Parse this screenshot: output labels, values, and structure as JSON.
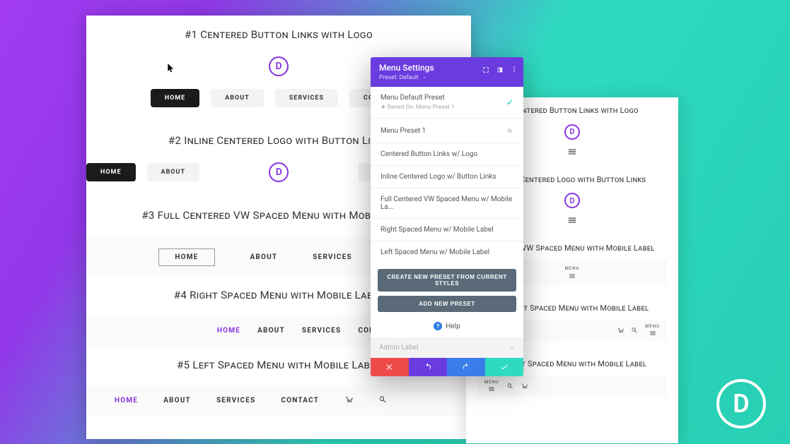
{
  "sections": {
    "s1": {
      "title": "#1 Centered Button Links with Logo"
    },
    "s2": {
      "title": "#2 Inline Centered Logo with Button Links"
    },
    "s3": {
      "title": "#3 Full Centered VW Spaced Menu with Mobile Label"
    },
    "s4": {
      "title": "#4 Right Spaced Menu with Mobile Label"
    },
    "s5": {
      "title": "#5 Left Spaced Menu with Mobile Label"
    }
  },
  "menu": {
    "home": "HOME",
    "about": "ABOUT",
    "services": "SERVICES",
    "contact": "CONTACT",
    "contact_trunc": "CONTAC",
    "contact_trunc2": "CO"
  },
  "mobile": {
    "s1": "1 Centered Button Links with Logo",
    "s2": "nline Centered Logo with Button Links",
    "s3": "entered VW Spaced Menu with Mobile Label",
    "s4": "#4 Right Spaced Menu with Mobile Label",
    "s5": "#5 Left Spaced Menu with Mobile Label",
    "menu_label": "MENU"
  },
  "popup": {
    "title": "Menu Settings",
    "preset_label": "Preset: Default",
    "items": [
      {
        "label": "Menu Default Preset",
        "sub": "Based On: Menu Preset 1",
        "checked": true
      },
      {
        "label": "Menu Preset 1",
        "star": true
      },
      {
        "label": "Centered Button Links w/ Logo"
      },
      {
        "label": "Inline Centered Logo w/ Button Links"
      },
      {
        "label": "Full Centered VW Spaced Menu w/ Mobile La..."
      },
      {
        "label": "Right Spaced Menu w/ Mobile Label"
      },
      {
        "label": "Left Spaced Menu w/ Mobile Label"
      }
    ],
    "btn_create": "CREATE NEW PRESET FROM CURRENT STYLES",
    "btn_add": "ADD NEW PRESET",
    "help": "Help",
    "admin_label": "Admin Label"
  }
}
